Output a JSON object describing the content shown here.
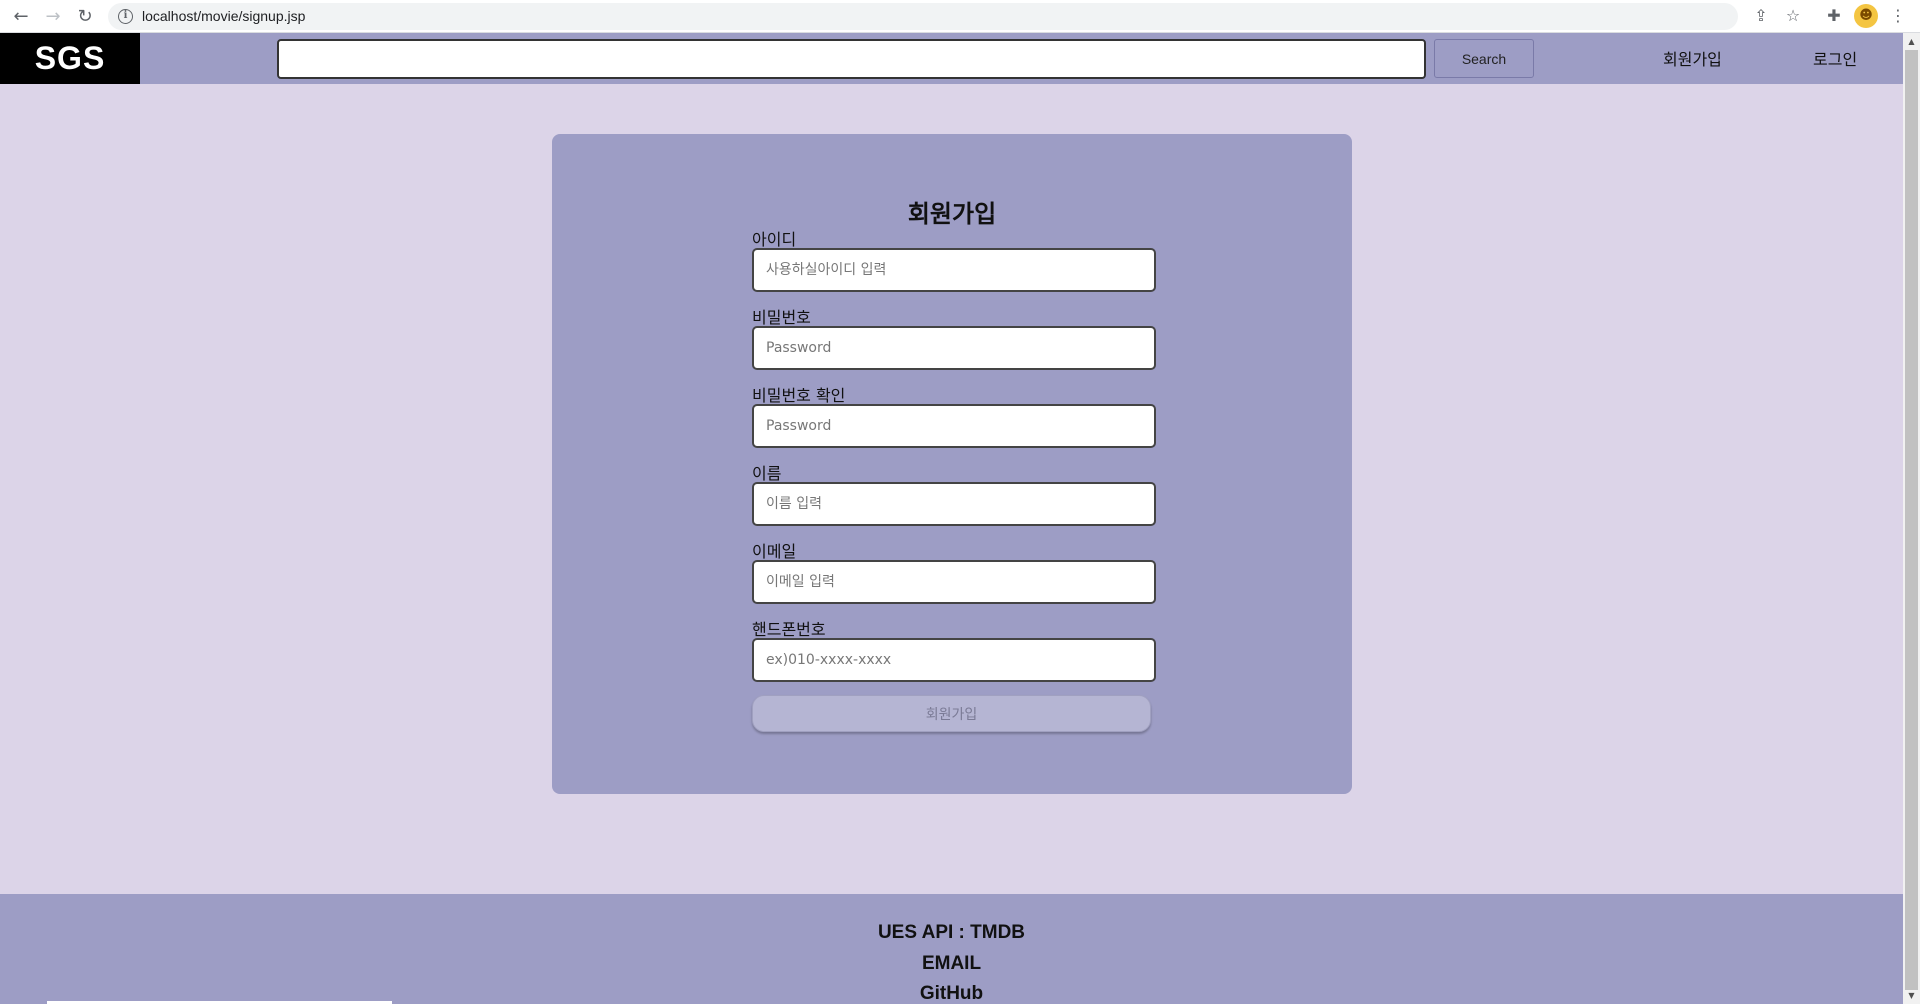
{
  "browser": {
    "url": "localhost/movie/signup.jsp"
  },
  "header": {
    "logo": "SGS",
    "search_value": "",
    "search_button": "Search",
    "signup_link": "회원가입",
    "login_link": "로그인"
  },
  "signup_form": {
    "title": "회원가입",
    "fields": [
      {
        "label": "아이디",
        "placeholder": "사용하실아이디 입력"
      },
      {
        "label": "비밀번호",
        "placeholder": "Password"
      },
      {
        "label": "비밀번호 확인",
        "placeholder": "Password"
      },
      {
        "label": "이름",
        "placeholder": "이름 입력"
      },
      {
        "label": "이메일",
        "placeholder": "이메일 입력"
      },
      {
        "label": "핸드폰번호",
        "placeholder": "ex)010-xxxx-xxxx"
      }
    ],
    "submit_label": "회원가입"
  },
  "footer": {
    "lines": [
      "UES API : TMDB",
      "EMAIL",
      "GitHub"
    ]
  },
  "colors": {
    "page_background": "#dcd4e8",
    "accent": "#9d9dc5",
    "logo_background": "#000000"
  }
}
